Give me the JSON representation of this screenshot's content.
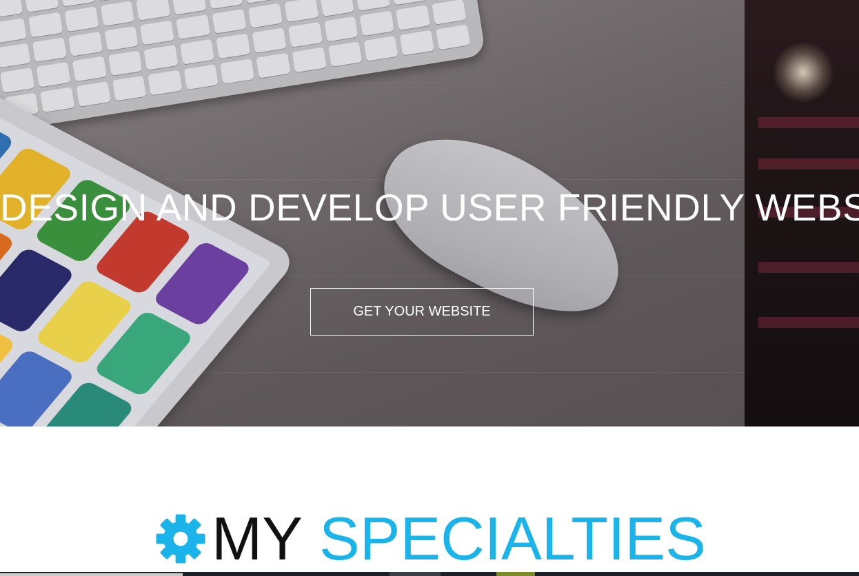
{
  "hero": {
    "title": "DESIGN AND DEVELOP USER FRIENDLY WEBSITE",
    "cta_label": "GET YOUR WEBSITE"
  },
  "specialties": {
    "icon": "gear-icon",
    "title_dark": "MY",
    "title_accent": "SPECIALTIES"
  },
  "colors": {
    "accent": "#1ab4ea",
    "title_dark": "#111111",
    "hero_text": "#ffffff"
  }
}
